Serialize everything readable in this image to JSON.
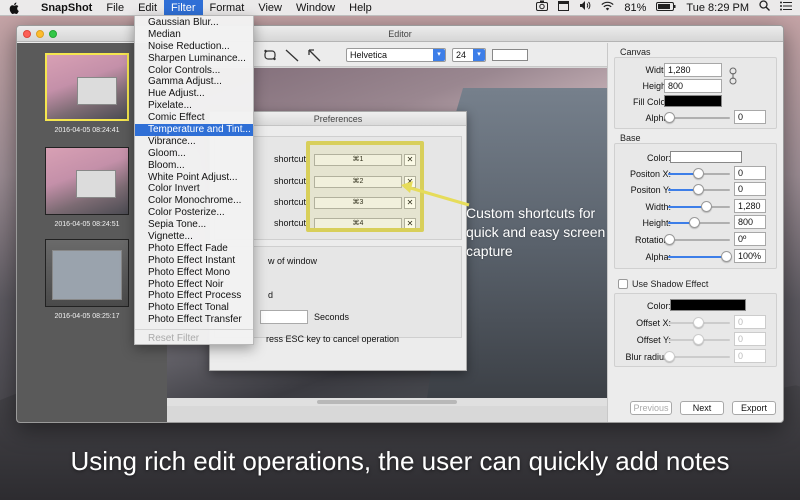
{
  "menubar": {
    "app_name": "SnapShot",
    "menus": [
      "File",
      "Edit",
      "Filter",
      "Format",
      "View",
      "Window",
      "Help"
    ],
    "active_menu": "Filter",
    "battery": "81%",
    "clock": "Tue 8:29 PM"
  },
  "filter_menu": {
    "items": [
      "Gaussian Blur...",
      "Median",
      "Noise Reduction...",
      "Sharpen Luminance...",
      "Color Controls...",
      "Gamma Adjust...",
      "Hue Adjust...",
      "Pixelate...",
      "Comic Effect",
      "Temperature and Tint...",
      "Vibrance...",
      "Gloom...",
      "Bloom...",
      "White Point Adjust...",
      "Color Invert",
      "Color Monochrome...",
      "Color Posterize...",
      "Sepia Tone...",
      "Vignette...",
      "Photo Effect Fade",
      "Photo Effect Instant",
      "Photo Effect Mono",
      "Photo Effect Noir",
      "Photo Effect Process",
      "Photo Effect Tonal",
      "Photo Effect Transfer"
    ],
    "highlighted_index": 9,
    "reset_label": "Reset Filter"
  },
  "window": {
    "title": "Editor"
  },
  "thumbnails": [
    {
      "timestamp": "2016-04-05 08:24:41",
      "selected": true
    },
    {
      "timestamp": "2016-04-05 08:24:51",
      "selected": false
    },
    {
      "timestamp": "2016-04-05 08:25:17",
      "selected": false
    }
  ],
  "toolbar": {
    "font_name": "Helvetica",
    "font_size": "24"
  },
  "preferences": {
    "title": "Preferences",
    "shortcut_label": "shortcut",
    "shortcuts": [
      "⌘1",
      "⌘2",
      "⌘3",
      "⌘4"
    ],
    "window_option_text": "w of window",
    "option_d_text": "d",
    "seconds_label": "Seconds",
    "esc_text": "ress ESC key to cancel operation"
  },
  "callout": {
    "text": "Custom shortcuts for quick and easy screen capture"
  },
  "inspector": {
    "canvas": {
      "title": "Canvas",
      "width_label": "Width:",
      "width_value": "1,280",
      "height_label": "Height:",
      "height_value": "800",
      "fill_color_label": "Fill Color:",
      "fill_color": "#000000",
      "alpha_label": "Alpha:",
      "alpha_value": "0"
    },
    "base": {
      "title": "Base",
      "color_label": "Color:",
      "color": "#ffffff",
      "position_x_label": "Positon X:",
      "position_x": "0",
      "position_y_label": "Positon Y:",
      "position_y": "0",
      "width_label": "Width:",
      "width": "1,280",
      "height_label": "Height:",
      "height": "800",
      "rotation_label": "Rotation:",
      "rotation": "0º",
      "alpha_label": "Alpha:",
      "alpha": "100%"
    },
    "shadow": {
      "toggle_label": "Use Shadow Effect",
      "color_label": "Color:",
      "color": "#000000",
      "offset_x_label": "Offset X:",
      "offset_x": "0",
      "offset_y_label": "Offset Y:",
      "offset_y": "0",
      "blur_label": "Blur radius:",
      "blur": "0"
    },
    "buttons": {
      "previous": "Previous",
      "next": "Next",
      "export": "Export"
    }
  },
  "caption": "Using rich edit operations, the user can quickly add notes"
}
